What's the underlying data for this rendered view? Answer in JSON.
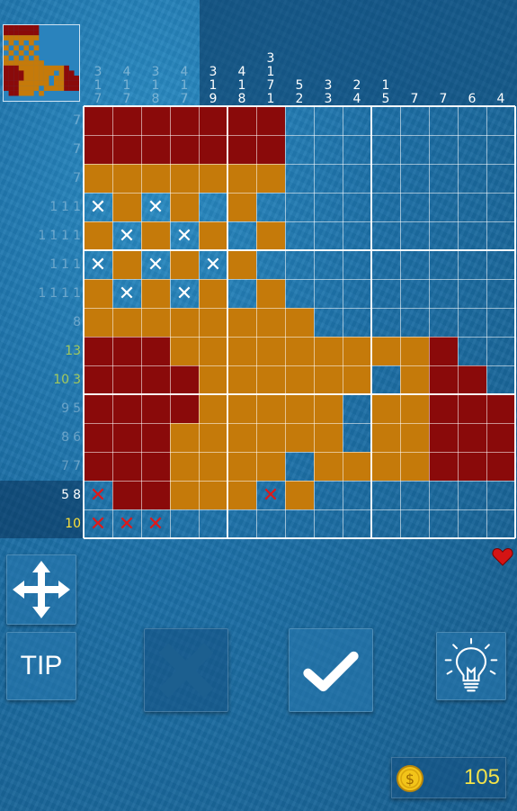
{
  "column_clues": [
    {
      "values": [
        "3",
        "1",
        "7"
      ],
      "done": true
    },
    {
      "values": [
        "4",
        "1",
        "7"
      ],
      "done": true
    },
    {
      "values": [
        "3",
        "1",
        "8"
      ],
      "done": true
    },
    {
      "values": [
        "4",
        "1",
        "7"
      ],
      "done": true
    },
    {
      "values": [
        "3",
        "1",
        "9"
      ],
      "done": false
    },
    {
      "values": [
        "4",
        "1",
        "8"
      ],
      "done": false
    },
    {
      "values": [
        "3",
        "1",
        "7",
        "1"
      ],
      "done": false
    },
    {
      "values": [
        "5",
        "2"
      ],
      "done": false
    },
    {
      "values": [
        "3",
        "3"
      ],
      "done": false
    },
    {
      "values": [
        "2",
        "4"
      ],
      "done": false
    },
    {
      "values": [
        "1",
        "5"
      ],
      "done": false
    },
    {
      "values": [
        "7"
      ],
      "done": false
    },
    {
      "values": [
        "7"
      ],
      "done": false
    },
    {
      "values": [
        "6"
      ],
      "done": false
    },
    {
      "values": [
        "4"
      ],
      "done": false
    }
  ],
  "row_clues": [
    {
      "values": [
        "7"
      ],
      "style": "done",
      "active": false
    },
    {
      "values": [
        "7"
      ],
      "style": "done",
      "active": false
    },
    {
      "values": [
        "7"
      ],
      "style": "done",
      "active": false
    },
    {
      "values": [
        "1",
        "1",
        "1"
      ],
      "style": "done",
      "active": false
    },
    {
      "values": [
        "1",
        "1",
        "1",
        "1"
      ],
      "style": "done",
      "active": false
    },
    {
      "values": [
        "1",
        "1",
        "1"
      ],
      "style": "done",
      "active": false
    },
    {
      "values": [
        "1",
        "1",
        "1",
        "1"
      ],
      "style": "done",
      "active": false
    },
    {
      "values": [
        "8"
      ],
      "style": "done",
      "active": false
    },
    {
      "values": [
        "13"
      ],
      "style": "green",
      "active": false
    },
    {
      "values": [
        "10",
        "3"
      ],
      "style": "green",
      "active": false
    },
    {
      "values": [
        "9",
        "5"
      ],
      "style": "done",
      "active": false
    },
    {
      "values": [
        "8",
        "6"
      ],
      "style": "done",
      "active": false
    },
    {
      "values": [
        "7",
        "7"
      ],
      "style": "done",
      "active": false
    },
    {
      "values": [
        "5",
        "8"
      ],
      "style": "white",
      "active": true
    },
    {
      "values": [
        "10"
      ],
      "style": "yellow",
      "active": true
    }
  ],
  "grid": [
    "RRRRRRR........",
    "RRRRRRR........",
    "OOOOOOO........",
    "wOwO.O.........",
    "OwOwO.O........",
    "wOwOwO.........",
    "OwOwO.O........",
    "OOOOOOOO.......",
    "RRROOOOOOOOOR..",
    "RRRROOOOOO.ORR.",
    "RRRROOOOO.OORRR",
    "RRROOOOOO.OORRR",
    "RRROOOO.OOOORRR",
    "xRROOOxO.......",
    "xxx............"
  ],
  "preview_grid": [
    "RRRRRRR........",
    "RRRRRRR........",
    "OOOOOOO........",
    ".O.O.O.........",
    "O.O.O.O........",
    ".O.O.O.........",
    "O.O.O.O........",
    "OOOOOOOO.......",
    "RRROOOOOOOOOR..",
    "RRRROOOOOO.ORR.",
    "RRRROOOOO.OORRR",
    "RRROOOOOO.OORRR",
    "RRROOOO.OOOORRR",
    "xRROOOxO.......",
    "xxx............"
  ],
  "controls": {
    "move_icon": "arrows-move-icon",
    "tip_label": "TIP",
    "cross_icon": "cross-mark-icon",
    "check_icon": "checkmark-icon",
    "hint_icon": "lightbulb-icon"
  },
  "lives": {
    "icon": "heart-icon",
    "count": 1
  },
  "coins": {
    "icon": "coin-icon",
    "value": "105"
  },
  "colors": {
    "filled_red": "#8a0a0a",
    "filled_orange": "#c57a0a",
    "cross_white": "#ffffff",
    "cross_red": "#e01818",
    "coin_text": "#f2e24a",
    "clue_yellow": "#ffe23a",
    "clue_green": "#a3c95c"
  }
}
